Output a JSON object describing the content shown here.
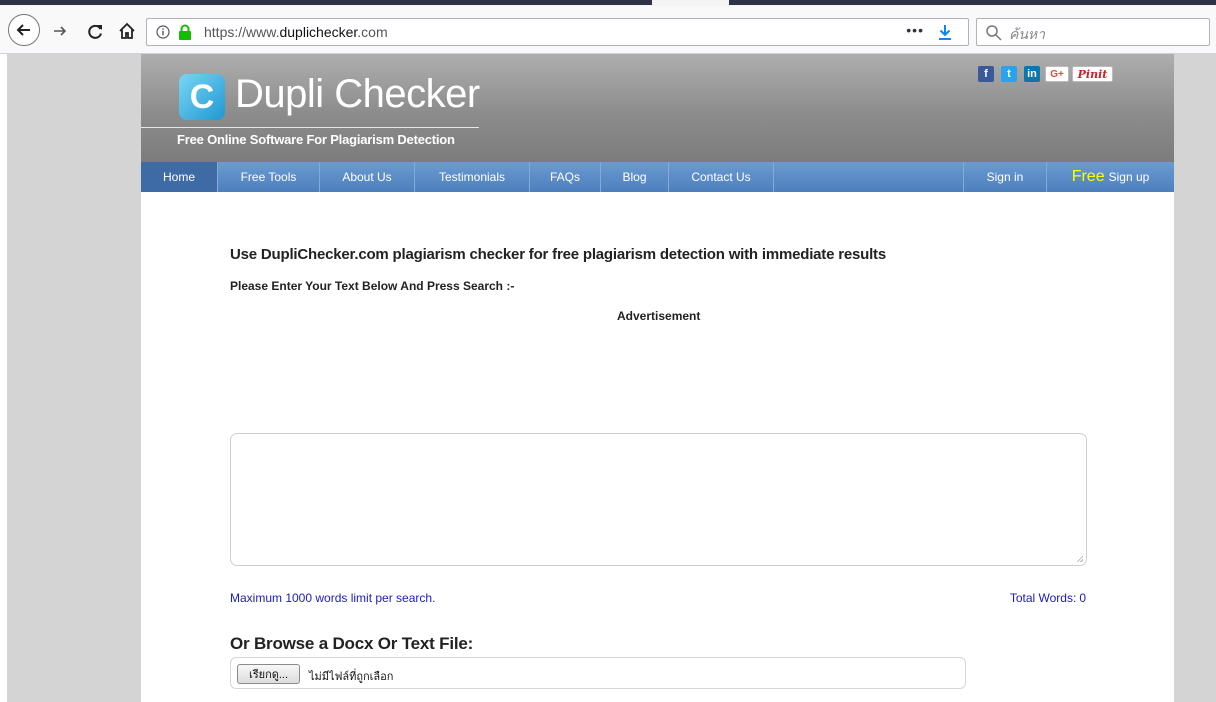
{
  "browser": {
    "url_prefix": "https://www.",
    "url_domain": "duplichecker",
    "url_suffix": ".com",
    "more": "•••",
    "search_placeholder": "ค้นหา"
  },
  "site": {
    "logo_letter": "C",
    "logo_text": "Dupli Checker",
    "tagline": "Free Online Software For Plagiarism Detection",
    "social": {
      "facebook": "f",
      "twitter": "t",
      "linkedin": "in",
      "googleplus": "G+",
      "pinterest": "Pinit"
    },
    "colors": {
      "nav": "#5a8cc8",
      "nav_active": "#3e6aa5",
      "free_highlight": "#ffff00",
      "link_blue": "#1a1ac8"
    }
  },
  "nav": {
    "items": [
      {
        "label": "Home"
      },
      {
        "label": "Free Tools"
      },
      {
        "label": "About Us"
      },
      {
        "label": "Testimonials"
      },
      {
        "label": "FAQs"
      },
      {
        "label": "Blog"
      },
      {
        "label": "Contact Us"
      }
    ],
    "signin": "Sign in",
    "signup_free": "Free",
    "signup": "Sign up"
  },
  "main": {
    "headline": "Use DupliChecker.com plagiarism checker for free plagiarism detection with immediate results",
    "subhead": "Please Enter Your Text Below And Press Search :-",
    "advertisement": "Advertisement",
    "textarea_value": "",
    "limit_note": "Maximum 1000 words limit per search.",
    "total_words_label": "Total Words:",
    "total_words_value": "0",
    "browse_title": "Or Browse a Docx Or Text File:",
    "file_button": "เรียกดู...",
    "file_status": "ไม่มีไฟล์ที่ถูกเลือก"
  }
}
